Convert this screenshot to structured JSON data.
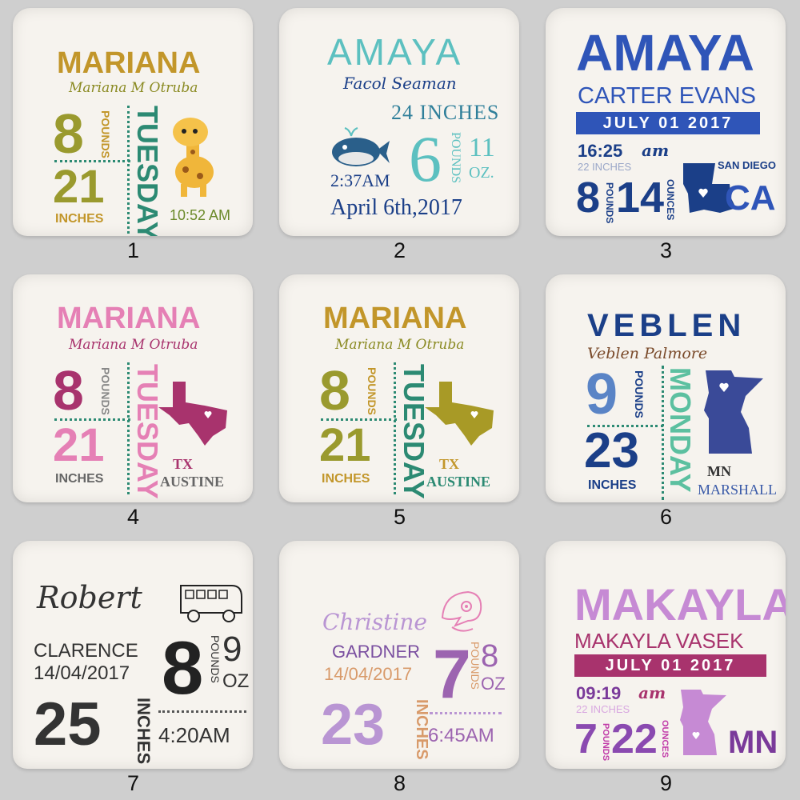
{
  "colors": {
    "mustard": "#c2962a",
    "olive": "#9a9a2e",
    "teal": "#2c8a73",
    "teal2": "#5cc0c0",
    "navy": "#1b3f88",
    "blue": "#2f55b8",
    "pink": "#e580b5",
    "magenta": "#a8336d",
    "violet": "#9c64b0",
    "lilac": "#b995d3",
    "purple": "#c03aa8",
    "gray": "#666666",
    "dark": "#333333"
  },
  "icons": [
    "giraffe-icon",
    "whale-icon",
    "louisiana-icon",
    "texas-icon",
    "minnesota-icon",
    "bus-icon",
    "dolphin-icon"
  ],
  "pillows": [
    {
      "label": "1",
      "name": "MARIANA",
      "full": "Mariana M Otruba",
      "weight": "8",
      "pounds": "POUNDS",
      "length": "21",
      "inches": "INCHES",
      "day": "TUESDAY",
      "time": "10:52 AM"
    },
    {
      "label": "2",
      "name": "AMAYA",
      "full": "Facol Seaman",
      "length": "24 INCHES",
      "weight": "6",
      "pounds": "POUNDS",
      "oz_num": "11",
      "oz": "OZ.",
      "time": "2:37AM",
      "date": "April 6th,2017"
    },
    {
      "label": "3",
      "name": "AMAYA",
      "full": "CARTER EVANS",
      "date": "JULY 01 2017",
      "time": "16:25",
      "ampm": "am",
      "inches": "22 INCHES",
      "weight": "8",
      "pounds": "POUNDS",
      "oz_num": "14",
      "oz": "OUNCES",
      "city": "SAN DIEGO",
      "state": "CA"
    },
    {
      "label": "4",
      "name": "MARIANA",
      "full": "Mariana M Otruba",
      "weight": "8",
      "pounds": "POUNDS",
      "length": "21",
      "inches": "INCHES",
      "day": "TUESDAY",
      "state": "TX",
      "city": "AUSTINE"
    },
    {
      "label": "5",
      "name": "MARIANA",
      "full": "Mariana M Otruba",
      "weight": "8",
      "pounds": "POUNDS",
      "length": "21",
      "inches": "INCHES",
      "day": "TUESDAY",
      "state": "TX",
      "city": "AUSTINE"
    },
    {
      "label": "6",
      "name": "VEBLEN",
      "full": "Veblen Palmore",
      "weight": "9",
      "pounds": "POUNDS",
      "length": "23",
      "inches": "INCHES",
      "day": "MONDAY",
      "state": "MN",
      "city": "MARSHALL"
    },
    {
      "label": "7",
      "name": "Robert",
      "middle": "CLARENCE",
      "date": "14/04/2017",
      "weight": "8",
      "oz_num": "9",
      "pounds": "POUNDS",
      "oz": "OZ",
      "length": "25",
      "inches": "INCHES",
      "time": "4:20AM"
    },
    {
      "label": "8",
      "name": "Christine",
      "middle": "GARDNER",
      "date": "14/04/2017",
      "weight": "7",
      "oz_num": "8",
      "pounds": "POUNDS",
      "oz": "OZ",
      "length": "23",
      "inches": "INCHES",
      "time": "6:45AM"
    },
    {
      "label": "9",
      "name": "MAKAYLA",
      "full": "MAKAYLA VASEK",
      "date": "JULY 01 2017",
      "time": "09:19",
      "ampm": "am",
      "inches": "22 INCHES",
      "weight": "7",
      "pounds": "POUNDS",
      "oz_num": "22",
      "oz": "OUNCES",
      "state": "MN"
    }
  ]
}
